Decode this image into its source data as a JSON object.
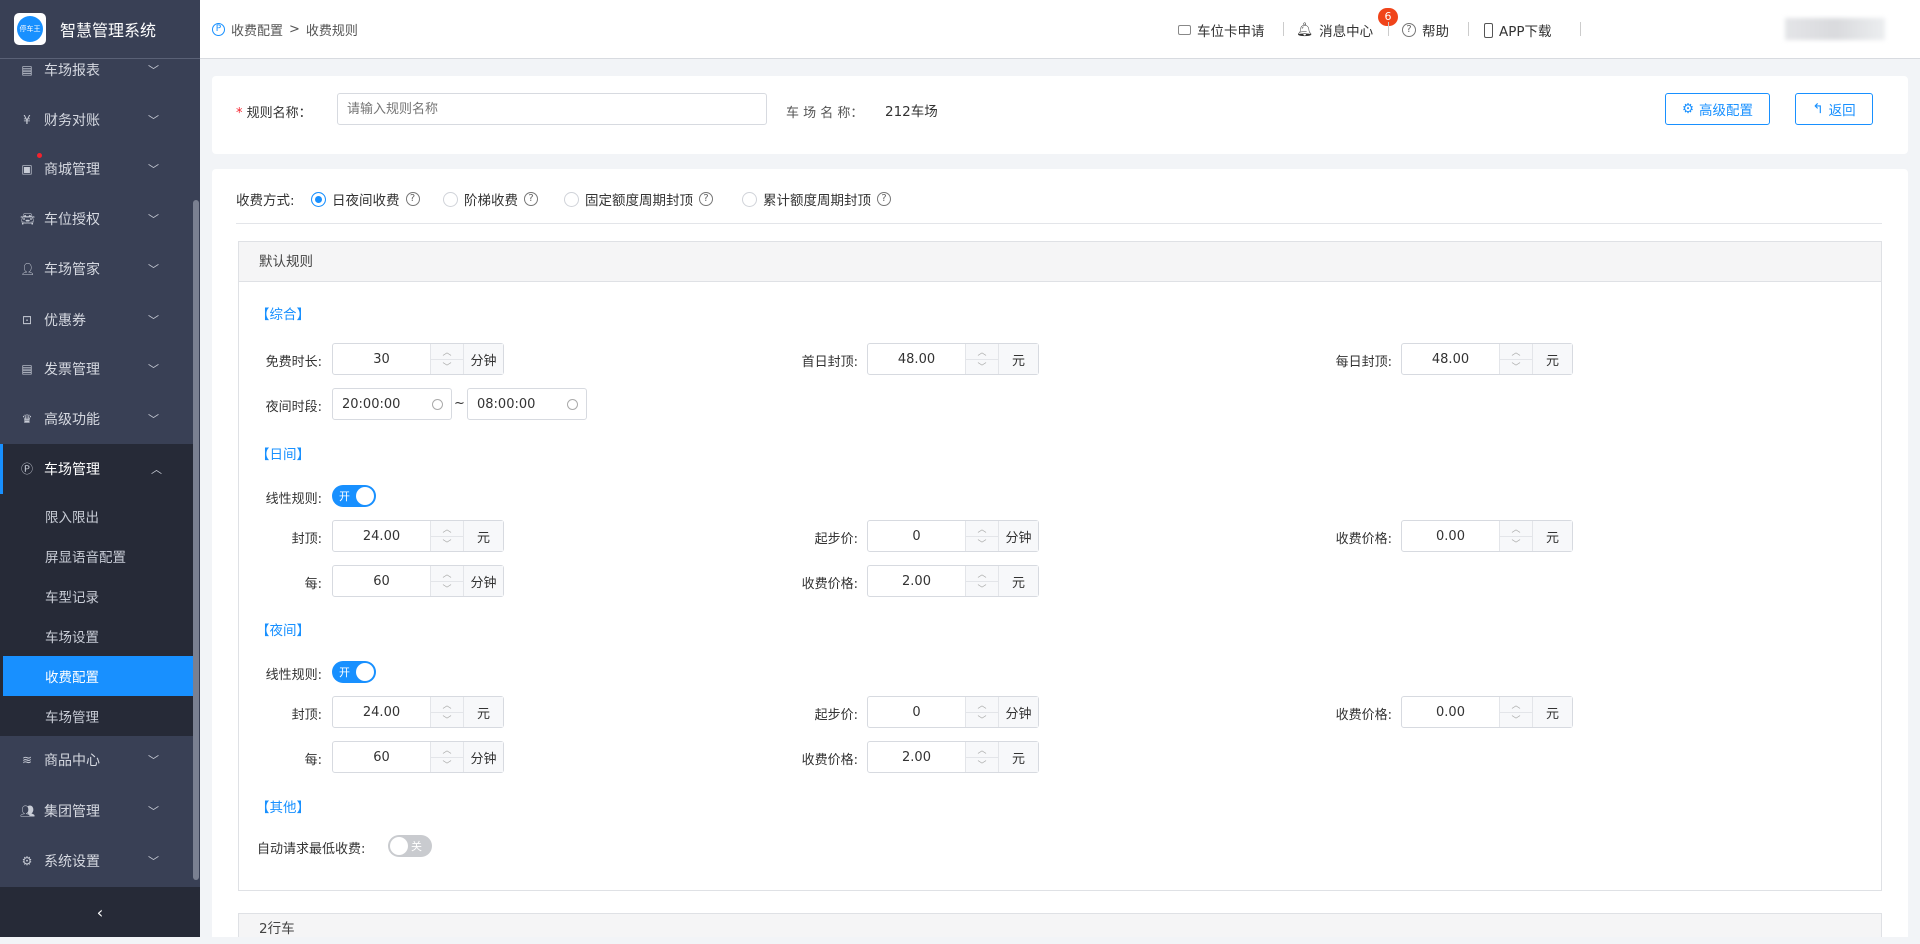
{
  "app": {
    "title": "智慧管理系统",
    "logo_text": "停车王"
  },
  "sidebar": {
    "items": [
      {
        "label": "车场报表",
        "icon": "report-icon"
      },
      {
        "label": "财务对账",
        "icon": "yen-icon"
      },
      {
        "label": "商城管理",
        "icon": "shop-icon",
        "dot": true
      },
      {
        "label": "车位授权",
        "icon": "car-icon"
      },
      {
        "label": "车场管家",
        "icon": "user-icon"
      },
      {
        "label": "优惠券",
        "icon": "coupon-icon"
      },
      {
        "label": "发票管理",
        "icon": "invoice-icon"
      },
      {
        "label": "高级功能",
        "icon": "crown-icon"
      },
      {
        "label": "车场管理",
        "icon": "parking-icon",
        "expanded": true
      },
      {
        "label": "商品中心",
        "icon": "layers-icon"
      },
      {
        "label": "集团管理",
        "icon": "group-icon"
      },
      {
        "label": "系统设置",
        "icon": "gear-icon"
      }
    ],
    "sub_items": [
      "限入限出",
      "屏显语音配置",
      "车型记录",
      "车场设置",
      "收费配置",
      "车场管理"
    ],
    "active_sub": "收费配置"
  },
  "header": {
    "breadcrumb": [
      "收费配置",
      "收费规则"
    ],
    "breadcrumb_sep": ">",
    "nav": [
      {
        "label": "车位卡申请",
        "badge": "6"
      },
      {
        "label": "消息中心"
      },
      {
        "label": "帮助"
      },
      {
        "label": "APP下载"
      }
    ]
  },
  "top_form": {
    "rule_name_label": "规则名称：",
    "rule_name_placeholder": "请输入规则名称",
    "rule_name_value": "",
    "lot_name_label": "车 场 名 称：",
    "lot_name_value": "212车场",
    "advanced_btn": "高级配置",
    "back_btn": "返回"
  },
  "billing": {
    "label": "收费方式:",
    "options": [
      "日夜间收费",
      "阶梯收费",
      "固定额度周期封顶",
      "累计额度周期封顶"
    ],
    "selected": "日夜间收费"
  },
  "default_rule": {
    "title": "默认规则",
    "general": {
      "title": "【综合】",
      "free_label": "免费时长:",
      "free_value": "30",
      "free_unit": "分钟",
      "first_cap_label": "首日封顶:",
      "first_cap_value": "48.00",
      "first_cap_unit": "元",
      "daily_cap_label": "每日封顶:",
      "daily_cap_value": "48.00",
      "daily_cap_unit": "元",
      "night_label": "夜间时段:",
      "night_start": "20:00:00",
      "night_end": "08:00:00",
      "tilde": "~"
    },
    "day": {
      "title": "【日间】",
      "linear_label": "线性规则:",
      "linear_on": "开",
      "cap_label": "封顶:",
      "cap_value": "24.00",
      "cap_unit": "元",
      "start_label": "起步价:",
      "start_value": "0",
      "start_unit": "分钟",
      "price_label": "收费价格:",
      "price_value": "0.00",
      "price_unit": "元",
      "per_label": "每:",
      "per_value": "60",
      "per_unit": "分钟",
      "per_price_label": "收费价格:",
      "per_price_value": "2.00",
      "per_price_unit": "元"
    },
    "night": {
      "title": "【夜间】",
      "linear_label": "线性规则:",
      "linear_on": "开",
      "cap_label": "封顶:",
      "cap_value": "24.00",
      "cap_unit": "元",
      "start_label": "起步价:",
      "start_value": "0",
      "start_unit": "分钟",
      "price_label": "收费价格:",
      "price_value": "0.00",
      "price_unit": "元",
      "per_label": "每:",
      "per_value": "60",
      "per_unit": "分钟",
      "per_price_label": "收费价格:",
      "per_price_value": "2.00",
      "per_price_unit": "元"
    },
    "other": {
      "title": "【其他】",
      "auto_min_label": "自动请求最低收费:",
      "auto_min_state": "关"
    }
  },
  "second_panel": {
    "title": "2行车"
  },
  "colors": {
    "accent": "#1890ff",
    "sidebar": "#394055",
    "sidebar_dark": "#262a37",
    "badge": "#f0441a"
  }
}
